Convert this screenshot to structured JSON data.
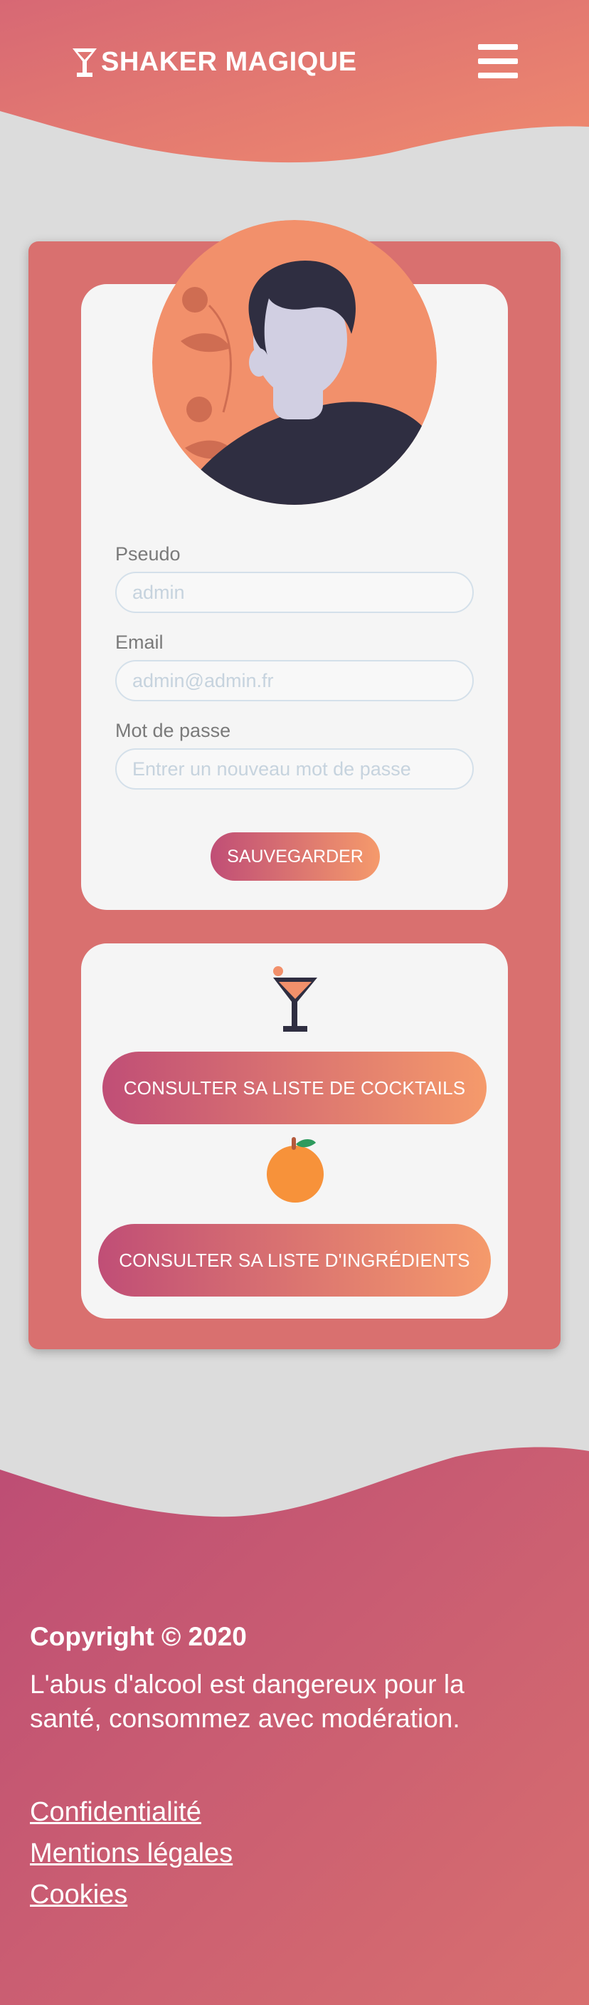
{
  "header": {
    "brand": "SHAKER MAGIQUE",
    "logo_icon": "cocktail-glass-icon",
    "menu_icon": "hamburger-menu-icon"
  },
  "profile": {
    "avatar_icon": "user-avatar-illustration",
    "pseudo_label": "Pseudo",
    "pseudo_placeholder": "admin",
    "email_label": "Email",
    "email_placeholder": "admin@admin.fr",
    "password_label": "Mot de passe",
    "password_placeholder": "Entrer un nouveau mot de passe",
    "save_label": "SAUVEGARDER"
  },
  "links": {
    "cocktail_icon": "cocktail-icon",
    "cocktails_label": "CONSULTER SA LISTE DE COCKTAILS",
    "orange_icon": "orange-icon",
    "ingredients_label": "CONSULTER SA LISTE D'INGRÉDIENTS"
  },
  "footer": {
    "copyright": "Copyright © 2020",
    "disclaimer": "L'abus d'alcool est dangereux pour la santé, consommez avec modération.",
    "links": [
      "Confidentialité",
      "Mentions légales",
      "Cookies"
    ]
  },
  "colors": {
    "brand_gradient_start": "#c04e76",
    "brand_gradient_end": "#f59a6b",
    "card_bg": "#d9706f",
    "page_bg": "#dcdcdc"
  }
}
